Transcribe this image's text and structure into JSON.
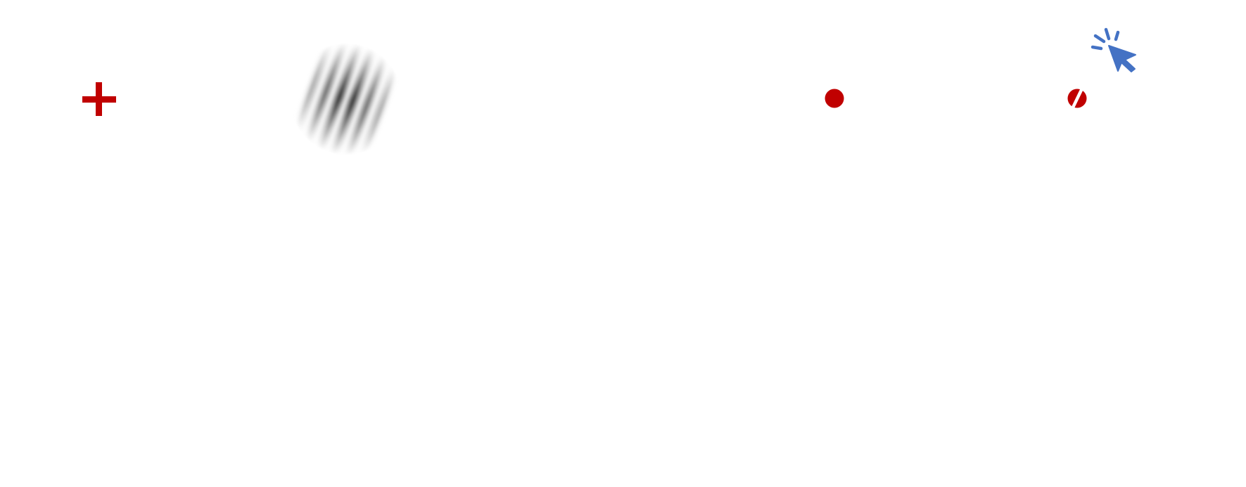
{
  "colors": {
    "background": "#ffffff",
    "stimulus_red": "#c00000",
    "click_blue": "#4472c4",
    "grating_dark": "#000000"
  },
  "items": [
    {
      "name": "fixation-cross",
      "icon": "plus-icon"
    },
    {
      "name": "gabor-patch",
      "icon": "tilted-grating"
    },
    {
      "name": "red-dot",
      "icon": "filled-circle-icon"
    },
    {
      "name": "crossed-red-dot",
      "icon": "slashed-circle-icon"
    },
    {
      "name": "mouse-click",
      "icon": "cursor-click-icon"
    }
  ]
}
